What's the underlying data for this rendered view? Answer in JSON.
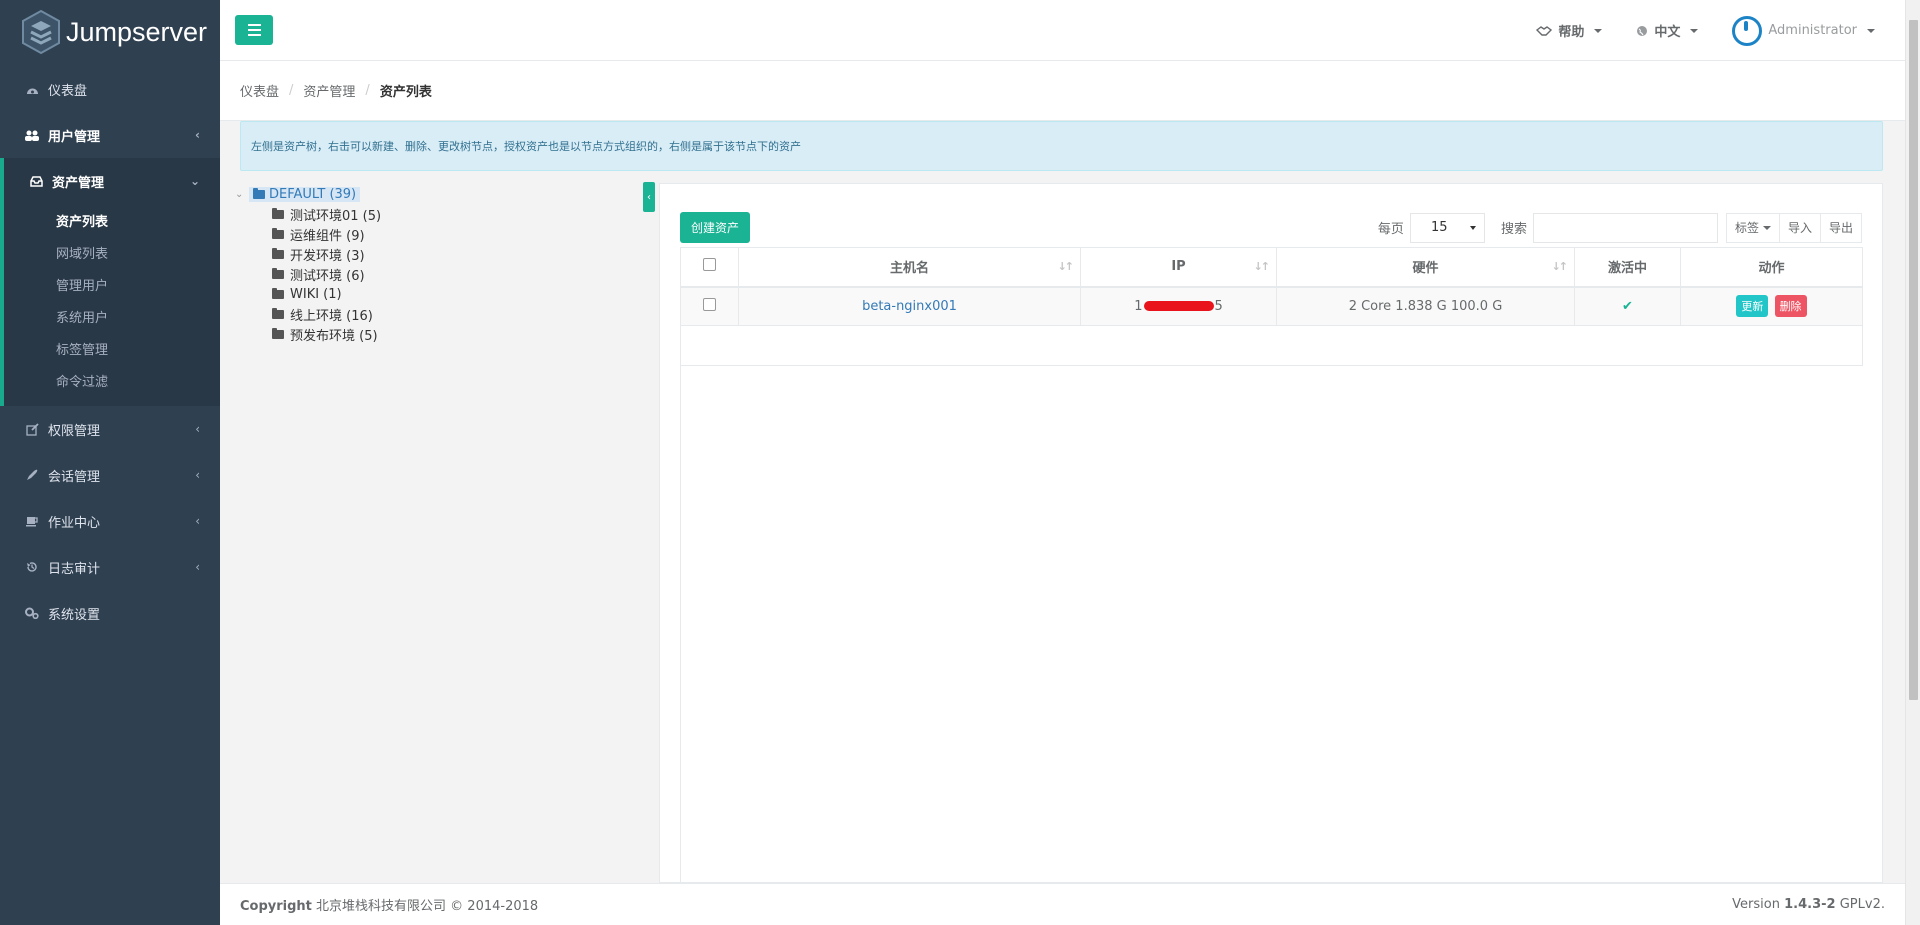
{
  "app": {
    "name": "Jumpserver"
  },
  "sidebar": {
    "items": [
      {
        "label": "仪表盘",
        "icon": "dashboard-icon"
      },
      {
        "label": "用户管理",
        "icon": "users-icon"
      },
      {
        "label": "资产管理",
        "icon": "inbox-icon"
      },
      {
        "label": "权限管理",
        "icon": "edit-icon"
      },
      {
        "label": "会话管理",
        "icon": "rocket-icon"
      },
      {
        "label": "作业中心",
        "icon": "coffee-icon"
      },
      {
        "label": "日志审计",
        "icon": "history-icon"
      },
      {
        "label": "系统设置",
        "icon": "gears-icon"
      }
    ],
    "asset_sub": [
      "资产列表",
      "网域列表",
      "管理用户",
      "系统用户",
      "标签管理",
      "命令过滤"
    ]
  },
  "topbar": {
    "help": "帮助",
    "language": "中文",
    "user": "Administrator"
  },
  "breadcrumb": [
    "仪表盘",
    "资产管理",
    "资产列表"
  ],
  "alert": "左侧是资产树，右击可以新建、删除、更改树节点，授权资产也是以节点方式组织的，右侧是属于该节点下的资产",
  "tree": {
    "root": "DEFAULT (39)",
    "children": [
      "测试环境01 (5)",
      "运维组件 (9)",
      "开发环境 (3)",
      "测试环境 (6)",
      "WIKI (1)",
      "线上环境 (16)",
      "预发布环境 (5)"
    ]
  },
  "toolbar": {
    "create": "创建资产",
    "per_page_label": "每页",
    "per_page_value": "15",
    "search_label": "搜索",
    "search_value": "",
    "tags": "标签",
    "import": "导入",
    "export": "导出"
  },
  "table": {
    "columns": [
      "主机名",
      "IP",
      "硬件",
      "激活中",
      "动作"
    ],
    "rows": [
      {
        "hostname": "beta-nginx001",
        "ip_prefix": "1",
        "ip_suffix": "5",
        "hardware": "2 Core 1.838 G 100.0 G",
        "active": "✔",
        "update": "更新",
        "delete": "删除"
      }
    ]
  },
  "footer": {
    "copyright_label": "Copyright",
    "copyright_text": "北京堆栈科技有限公司 © 2014-2018",
    "version_label": "Version",
    "version_number": "1.4.3-2",
    "license": "GPLv2."
  },
  "colors": {
    "primary": "#1ab394",
    "sidebar": "#2f4050",
    "info": "#23c6c8",
    "danger": "#ed5565",
    "link": "#337ab7"
  }
}
